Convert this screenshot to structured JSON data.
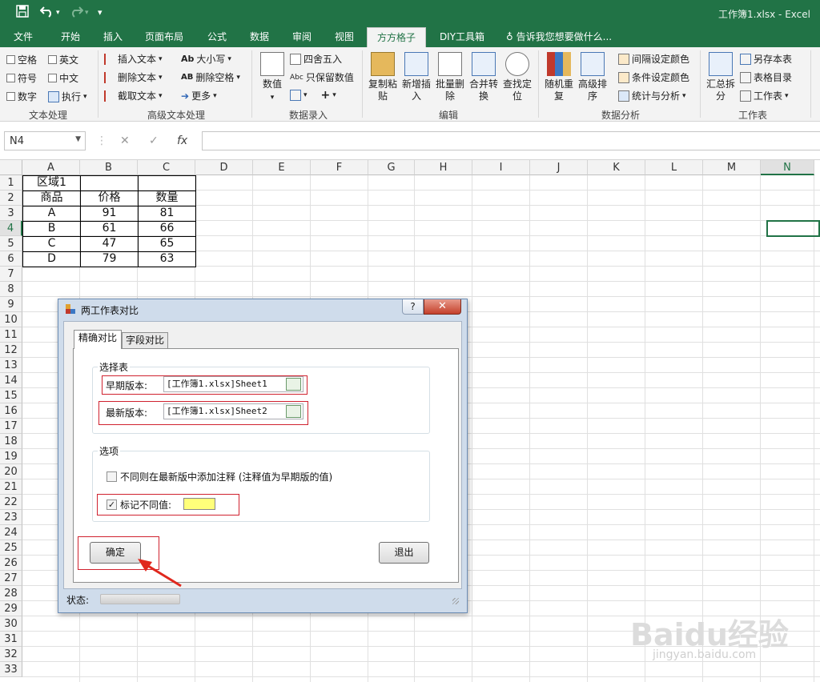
{
  "window": {
    "title": "工作簿1.xlsx - Excel"
  },
  "quick_access": {
    "save_icon": "save-icon",
    "undo_icon": "undo-icon",
    "redo_icon": "redo-icon",
    "customize_icon": "customize-icon"
  },
  "tabs": [
    {
      "label": "文件"
    },
    {
      "label": "开始"
    },
    {
      "label": "插入"
    },
    {
      "label": "页面布局"
    },
    {
      "label": "公式"
    },
    {
      "label": "数据"
    },
    {
      "label": "审阅"
    },
    {
      "label": "视图"
    },
    {
      "label": "方方格子"
    },
    {
      "label": "DIY工具箱"
    },
    {
      "label": "告诉我您想要做什么..."
    }
  ],
  "ribbon": {
    "text_processing": {
      "items": [
        "空格",
        "英文",
        "符号",
        "中文",
        "数字",
        "执行"
      ],
      "label": "文本处理"
    },
    "advanced_text": {
      "items": [
        "插入文本",
        "大小写",
        "删除文本",
        "删除空格",
        "截取文本",
        "更多"
      ],
      "label": "高级文本处理"
    },
    "data_entry": {
      "numbers": "数值",
      "round": "四舍五入",
      "keep": "只保留数值",
      "label": "数据录入"
    },
    "edit": {
      "buttons": [
        "复制粘贴",
        "新增插入",
        "批量删除",
        "合并转换",
        "查找定位"
      ],
      "label": "编辑"
    },
    "analysis": {
      "buttons": [
        "随机重复",
        "高级排序"
      ],
      "items": [
        "间隔设定颜色",
        "条件设定颜色",
        "统计与分析"
      ],
      "label": "数据分析"
    },
    "worksheet": {
      "buttons": [
        "汇总拆分"
      ],
      "items": [
        "另存本表",
        "表格目录",
        "工作表"
      ],
      "label": "工作表"
    }
  },
  "formula_bar": {
    "name_box": "N4",
    "fx": "fx",
    "value": ""
  },
  "sheet": {
    "columns": [
      "A",
      "B",
      "C",
      "D",
      "E",
      "F",
      "G",
      "H",
      "I",
      "J",
      "K",
      "L",
      "M",
      "N"
    ],
    "rows": [
      "1",
      "2",
      "3",
      "4",
      "5",
      "6",
      "7",
      "8",
      "9",
      "10",
      "11",
      "12",
      "13",
      "14",
      "15",
      "16",
      "17",
      "18",
      "19",
      "20",
      "21",
      "22",
      "23",
      "24",
      "25",
      "26",
      "27",
      "28",
      "29",
      "30",
      "31",
      "32",
      "33"
    ],
    "selected_cell": "N4",
    "table": {
      "r1": [
        "区域1",
        "",
        ""
      ],
      "r2": [
        "商品",
        "价格",
        "数量"
      ],
      "r3": [
        "A",
        "91",
        "81"
      ],
      "r4": [
        "B",
        "61",
        "66"
      ],
      "r5": [
        "C",
        "47",
        "65"
      ],
      "r6": [
        "D",
        "79",
        "63"
      ]
    }
  },
  "dialog": {
    "title": "两工作表对比",
    "help": "?",
    "close": "✕",
    "tabs": [
      "精确对比",
      "字段对比"
    ],
    "select_group": "选择表",
    "early_label": "早期版本:",
    "early_value": "[工作簿1.xlsx]Sheet1",
    "latest_label": "最新版本:",
    "latest_value": "[工作簿1.xlsx]Sheet2",
    "options_group": "选项",
    "opt_comment": "不同则在最新版中添加注释 (注释值为早期版的值)",
    "opt_comment_checked": false,
    "opt_mark": "标记不同值:",
    "opt_mark_checked": true,
    "mark_color": "#ffff7a",
    "ok": "确定",
    "exit": "退出",
    "status_label": "状态:"
  },
  "watermark": {
    "brand": "Baidu经验",
    "url": "jingyan.baidu.com"
  }
}
